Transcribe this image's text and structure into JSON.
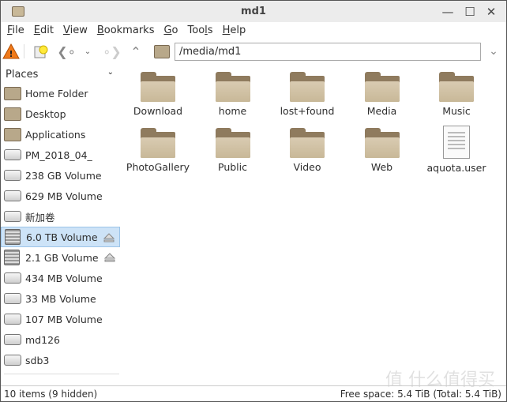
{
  "window": {
    "title": "md1"
  },
  "menu": [
    {
      "u": "F",
      "rest": "ile"
    },
    {
      "u": "E",
      "rest": "dit"
    },
    {
      "u": "V",
      "rest": "iew"
    },
    {
      "u": "B",
      "rest": "ookmarks"
    },
    {
      "u": "G",
      "rest": "o"
    },
    {
      "u": "",
      "rest": "Too",
      "u2": "l",
      "rest2": "s"
    },
    {
      "u": "H",
      "rest": "elp"
    }
  ],
  "location": {
    "path": "/media/md1"
  },
  "sidebar": {
    "header": "Places",
    "items": [
      {
        "label": "Home Folder",
        "icon": "home-folder-icon"
      },
      {
        "label": "Desktop",
        "icon": "desktop-folder-icon"
      },
      {
        "label": "Applications",
        "icon": "applications-icon"
      },
      {
        "label": "PM_2018_04_",
        "icon": "drive-icon"
      },
      {
        "label": "238 GB Volume",
        "icon": "drive-icon"
      },
      {
        "label": "629 MB Volume",
        "icon": "drive-icon"
      },
      {
        "label": "新加卷",
        "icon": "drive-icon"
      },
      {
        "label": "6.0 TB Volume",
        "icon": "hdd-icon",
        "selected": true,
        "eject": true
      },
      {
        "label": "2.1 GB Volume",
        "icon": "hdd-icon",
        "eject": true
      },
      {
        "label": "434 MB Volume",
        "icon": "drive-icon"
      },
      {
        "label": "33 MB Volume",
        "icon": "drive-icon"
      },
      {
        "label": "107 MB Volume",
        "icon": "drive-icon"
      },
      {
        "label": "md126",
        "icon": "drive-icon"
      },
      {
        "label": "sdb3",
        "icon": "drive-icon"
      }
    ]
  },
  "files": [
    {
      "name": "Download",
      "type": "folder"
    },
    {
      "name": "home",
      "type": "folder"
    },
    {
      "name": "lost+found",
      "type": "folder"
    },
    {
      "name": "Media",
      "type": "folder"
    },
    {
      "name": "Music",
      "type": "folder"
    },
    {
      "name": "PhotoGallery",
      "type": "folder"
    },
    {
      "name": "Public",
      "type": "folder"
    },
    {
      "name": "Video",
      "type": "folder"
    },
    {
      "name": "Web",
      "type": "folder"
    },
    {
      "name": "aquota.user",
      "type": "file"
    }
  ],
  "status": {
    "left": "10 items (9 hidden)",
    "right": "Free space: 5.4 TiB (Total: 5.4 TiB)"
  },
  "watermark": "值 什么值得买"
}
